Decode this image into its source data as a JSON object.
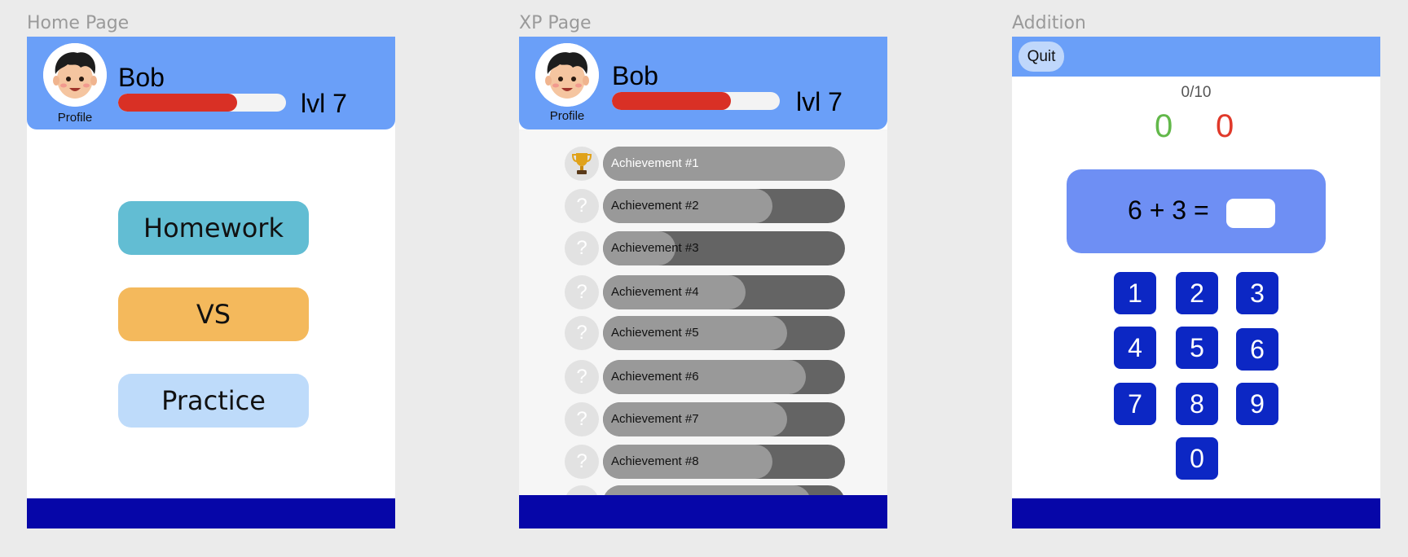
{
  "frames": {
    "home": {
      "title": "Home Page"
    },
    "xp": {
      "title": "XP Page"
    },
    "addition": {
      "title": "Addition"
    }
  },
  "profile": {
    "name": "Bob",
    "avatar_label": "Profile",
    "level": "lvl 7",
    "xp_progress": 0.71,
    "avatar_icon": "boy-avatar-icon"
  },
  "home": {
    "buttons": [
      {
        "label": "Homework",
        "color": "#62bdd3"
      },
      {
        "label": "VS",
        "color": "#f4b95c"
      },
      {
        "label": "Practice",
        "color": "#bedbfa"
      }
    ]
  },
  "xp": {
    "achievements": [
      {
        "label": "Achievement #1",
        "progress": 1.0,
        "icon": "trophy-icon",
        "unlocked": true
      },
      {
        "label": "Achievement #2",
        "progress": 0.7,
        "icon": "question-mark-icon",
        "unlocked": false
      },
      {
        "label": "Achievement #3",
        "progress": 0.3,
        "icon": "question-mark-icon",
        "unlocked": false
      },
      {
        "label": "Achievement #4",
        "progress": 0.59,
        "icon": "question-mark-icon",
        "unlocked": false
      },
      {
        "label": "Achievement #5",
        "progress": 0.76,
        "icon": "question-mark-icon",
        "unlocked": false
      },
      {
        "label": "Achievement #6",
        "progress": 0.84,
        "icon": "question-mark-icon",
        "unlocked": false
      },
      {
        "label": "Achievement #7",
        "progress": 0.76,
        "icon": "question-mark-icon",
        "unlocked": false
      },
      {
        "label": "Achievement #8",
        "progress": 0.7,
        "icon": "question-mark-icon",
        "unlocked": false
      }
    ]
  },
  "addition": {
    "quit_label": "Quit",
    "progress_text": "0/10",
    "correct_count": "0",
    "wrong_count": "0",
    "question": "6 + 3 =",
    "answer_value": "",
    "keys": [
      "1",
      "2",
      "3",
      "4",
      "5",
      "6",
      "7",
      "8",
      "9",
      "0"
    ]
  },
  "colors": {
    "header": "#6a9ff8",
    "footer": "#0606a8",
    "xp_fill": "#d93025",
    "keypad": "#0c27c4",
    "question_box": "#6e8ff4",
    "correct": "#62b84a",
    "wrong": "#e0392a"
  }
}
